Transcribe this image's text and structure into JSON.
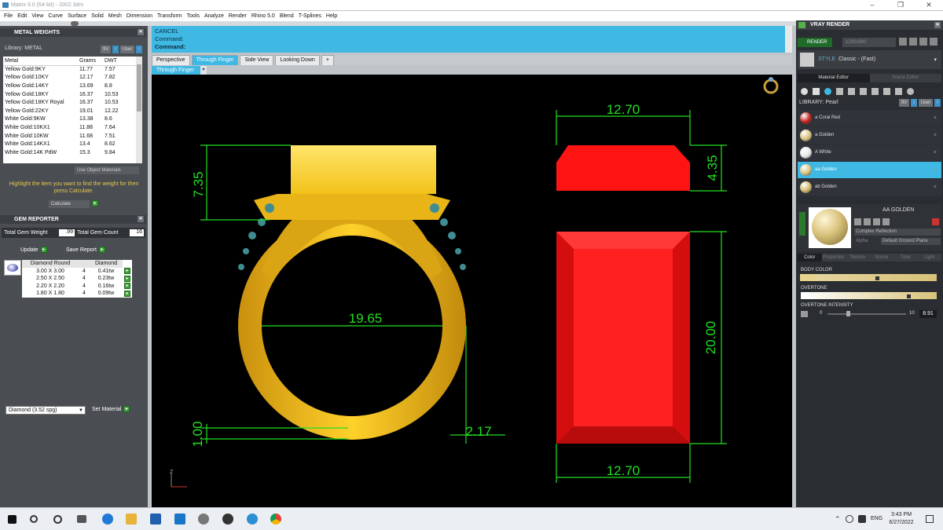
{
  "app": {
    "window_title": "Matrix 9.0 (64-bit) - 3302.3dm",
    "menu": [
      "File",
      "Edit",
      "View",
      "Curve",
      "Surface",
      "Solid",
      "Mesh",
      "Dimension",
      "Transform",
      "Tools",
      "Analyze",
      "Render",
      "Rhino 5.0",
      "Blend",
      "T-Splines",
      "Help"
    ]
  },
  "metal_weights": {
    "title": "METAL WEIGHTS",
    "library_label": "Library: METAL",
    "lib_btns": [
      "9V",
      "User"
    ],
    "columns": [
      "Metal",
      "Grams",
      "DWT"
    ],
    "rows": [
      [
        "Yellow Gold:9KY",
        "11.77",
        "7.57"
      ],
      [
        "Yellow Gold:10KY",
        "12.17",
        "7.82"
      ],
      [
        "Yellow Gold:14KY",
        "13.69",
        "8.8"
      ],
      [
        "Yellow Gold:18KY",
        "16.37",
        "10.53"
      ],
      [
        "Yellow Gold:18KY Royal",
        "16.37",
        "10.53"
      ],
      [
        "Yellow Gold:22KY",
        "19.01",
        "12.22"
      ],
      [
        "White Gold:9KW",
        "13.38",
        "8.6"
      ],
      [
        "White Gold:10KX1",
        "11.88",
        "7.64"
      ],
      [
        "White Gold:10KW",
        "11.68",
        "7.51"
      ],
      [
        "White Gold:14KX1",
        "13.4",
        "8.62"
      ],
      [
        "White Gold:14K PdW",
        "15.3",
        "9.84"
      ]
    ],
    "use_object_materials": "Use Object Materials",
    "hint": "Highlight the item you want to find the weight for then press Calculate.",
    "calculate": "Calculate"
  },
  "gem_reporter": {
    "title": "GEM REPORTER",
    "total_weight_label": "Total Gem Weight",
    "total_weight_value": ".99",
    "total_count_label": "Total Gem Count",
    "total_count_value": "16",
    "update": "Update",
    "save_report": "Save Report",
    "columns": [
      "Diamond Round",
      "",
      "Diamond"
    ],
    "rows": [
      [
        "3.00 X 3.00",
        "4",
        "0.41tw"
      ],
      [
        "2.50 X 2.50",
        "4",
        "0.23tw"
      ],
      [
        "2.20 X 2.20",
        "4",
        "0.16tw"
      ],
      [
        "1.80 X 1.80",
        "4",
        "0.09tw"
      ]
    ],
    "material_select": "Diamond    (3.52 spg)",
    "set_material": "Set Material"
  },
  "command": {
    "line1": "CANCEL",
    "line2": "Command:",
    "prompt": "Command:"
  },
  "tabs": [
    "Perspective",
    "Through Finger",
    "Side View",
    "Looking Down"
  ],
  "viewport_tab": "Through Finger",
  "dimensions": {
    "ring_height": "7.35",
    "inner_diameter": "19.65",
    "band_bottom": "1.00",
    "shank_width": "2.17",
    "top_width": "12.70",
    "top_height": "4.35",
    "face_height": "20.00",
    "bottom_width": "12.70"
  },
  "axis_label": "Z",
  "vray": {
    "title": "VRAY RENDER",
    "render_btn": "RENDER",
    "resolution": "1200x900",
    "style_label": "STYLE",
    "style_value": "Classic - (Fast)",
    "tabs": [
      "Material Editor",
      "Scene Editor"
    ],
    "library_label": "LIBRARY: Pearl",
    "lib_btns": [
      "9V",
      "User"
    ],
    "materials": [
      {
        "name": "a Coral Red",
        "color": "#c0201b"
      },
      {
        "name": "a Golden",
        "color": "#d6c07a"
      },
      {
        "name": "A White",
        "color": "#e6e6e6"
      },
      {
        "name": "aa Golden",
        "color": "#d6c07a"
      },
      {
        "name": "ab Golden",
        "color": "#cfb56a"
      }
    ],
    "selected_material": "AA GOLDEN",
    "reflection": "Complex Reflection",
    "alpha": "Alpha",
    "ground": "Default Ground Plane",
    "subtabs": [
      "Color",
      "Properties",
      "Texture",
      "Scene",
      "Tone",
      "Light"
    ],
    "body_color": "BODY COLOR",
    "overtone": "OVERTONE",
    "overtone_intensity": "OVERTONE INTENSITY",
    "slider_min": "0",
    "slider_max": "10",
    "slider_value": "8.91"
  },
  "taskbar": {
    "time": "3:43 PM",
    "date": "6/27/2022",
    "lang": "ENG"
  },
  "colors": {
    "accent": "#3fb8e4",
    "gold": "#f2c21a",
    "dim_green": "#22e022",
    "red_block": "#ff1a1a"
  }
}
